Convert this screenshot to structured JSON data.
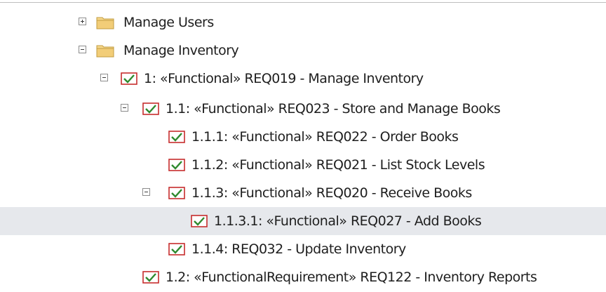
{
  "tree": {
    "items": [
      {
        "id": "manage-users",
        "label": "Manage Users",
        "icon": "folder-icon",
        "expander": "expand"
      },
      {
        "id": "manage-inventory",
        "label": "Manage Inventory",
        "icon": "folder-icon",
        "expander": "collapse"
      },
      {
        "id": "req019",
        "label": "1: «Functional» REQ019 - Manage Inventory",
        "icon": "requirement-icon",
        "expander": "collapse"
      },
      {
        "id": "req023",
        "label": "1.1: «Functional» REQ023 - Store and Manage Books",
        "icon": "requirement-icon",
        "expander": "collapse"
      },
      {
        "id": "req022",
        "label": "1.1.1: «Functional» REQ022 - Order Books",
        "icon": "requirement-icon",
        "expander": "none"
      },
      {
        "id": "req021",
        "label": "1.1.2: «Functional» REQ021 - List Stock Levels",
        "icon": "requirement-icon",
        "expander": "none"
      },
      {
        "id": "req020",
        "label": "1.1.3: «Functional» REQ020 - Receive Books",
        "icon": "requirement-icon",
        "expander": "collapse"
      },
      {
        "id": "req027",
        "label": "1.1.3.1: «Functional» REQ027 - Add Books",
        "icon": "requirement-icon",
        "expander": "none",
        "selected": true
      },
      {
        "id": "req032",
        "label": "1.1.4: REQ032 - Update Inventory",
        "icon": "requirement-icon",
        "expander": "none"
      },
      {
        "id": "req122",
        "label": "1.2: «FunctionalRequirement» REQ122 - Inventory Reports",
        "icon": "requirement-icon",
        "expander": "none"
      }
    ]
  },
  "colors": {
    "selection": "#e6e8ec",
    "folder": "#f2cd78",
    "requirement_border": "#c62d2d",
    "requirement_check": "#2f8a2f"
  }
}
